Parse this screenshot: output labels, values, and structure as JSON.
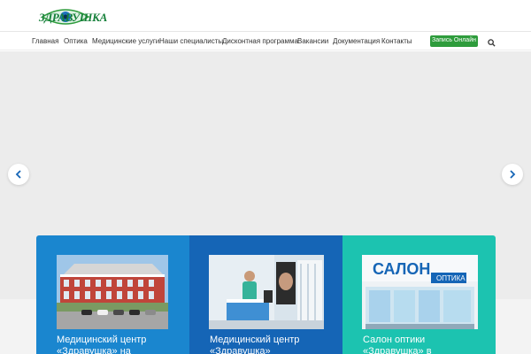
{
  "header": {
    "logo_text": "ЗДРАВУШКА"
  },
  "nav": {
    "items": [
      {
        "label": "Главная"
      },
      {
        "label": "Оптика"
      },
      {
        "label": "Медицинские услуги"
      },
      {
        "label": "Наши специалисты"
      },
      {
        "label": "Дисконтная программа"
      },
      {
        "label": "Вакансии"
      },
      {
        "label": "Документация"
      },
      {
        "label": "Контакты"
      }
    ],
    "signup_label": "Запись Онлайн",
    "search_icon": "search-icon"
  },
  "slider": {
    "prev_icon": "chevron-left-icon",
    "next_icon": "chevron-right-icon"
  },
  "cards": [
    {
      "title": "Медицинский центр «Здравушка» на",
      "color": "#1a86cf"
    },
    {
      "title": "Медицинский центр «Здравушка»",
      "color": "#1565b6"
    },
    {
      "title": "Салон оптики «Здравушка» в",
      "color": "#1cc3b0"
    }
  ],
  "colors": {
    "brand_green": "#2e9c3c",
    "slider_bg": "#ececec"
  }
}
